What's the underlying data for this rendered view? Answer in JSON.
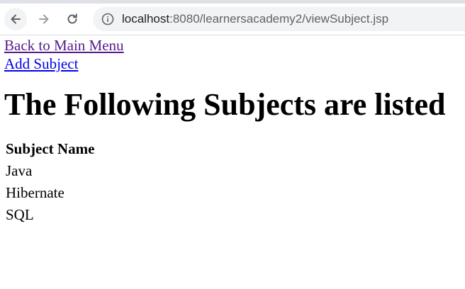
{
  "browser": {
    "url_host": "localhost",
    "url_path": ":8080/learnersacademy2/viewSubject.jsp",
    "icons": {
      "back": "arrow-left-icon",
      "forward": "arrow-right-icon",
      "reload": "reload-icon",
      "site_info": "info-icon"
    }
  },
  "links": {
    "back_to_main_menu": "Back to Main Menu",
    "add_subject": "Add Subject"
  },
  "heading": "The Following Subjects are listed",
  "subjects_table": {
    "header": "Subject Name",
    "rows": [
      "Java",
      "Hibernate",
      "SQL"
    ]
  },
  "colors": {
    "visited_link": "#551a8b",
    "unvisited_link": "#0000ee"
  }
}
